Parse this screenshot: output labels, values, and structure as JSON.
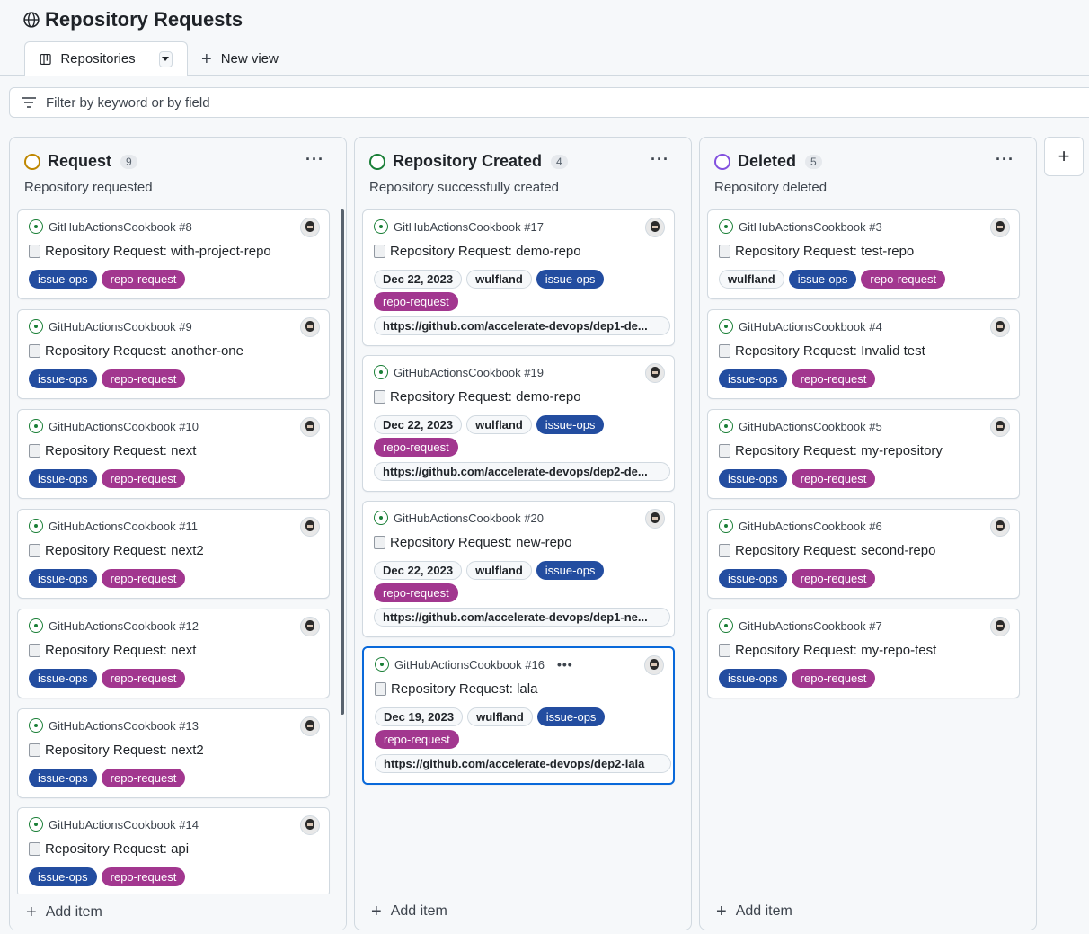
{
  "project": {
    "title": "Repository Requests",
    "icon": "globe-icon"
  },
  "tabs": {
    "active_label": "Repositories",
    "new_view_label": "New view"
  },
  "filter": {
    "placeholder": "Filter by keyword or by field"
  },
  "colors": {
    "request": "#bf8700",
    "created": "#1a7f37",
    "deleted": "#8250df",
    "issue_ops": "#234da0",
    "repo_request": "#a2378f",
    "selected": "#0969da"
  },
  "columns": [
    {
      "title": "Request",
      "count": "9",
      "description": "Repository requested",
      "add_item": "Add item",
      "cards": [
        {
          "repo": "GitHubActionsCookbook #8",
          "title": "Repository Request: with-project-repo",
          "labels": [
            "issue-ops",
            "repo-request"
          ]
        },
        {
          "repo": "GitHubActionsCookbook #9",
          "title": "Repository Request: another-one",
          "labels": [
            "issue-ops",
            "repo-request"
          ]
        },
        {
          "repo": "GitHubActionsCookbook #10",
          "title": "Repository Request: next",
          "labels": [
            "issue-ops",
            "repo-request"
          ]
        },
        {
          "repo": "GitHubActionsCookbook #11",
          "title": "Repository Request: next2",
          "labels": [
            "issue-ops",
            "repo-request"
          ]
        },
        {
          "repo": "GitHubActionsCookbook #12",
          "title": "Repository Request: next",
          "labels": [
            "issue-ops",
            "repo-request"
          ]
        },
        {
          "repo": "GitHubActionsCookbook #13",
          "title": "Repository Request: next2",
          "labels": [
            "issue-ops",
            "repo-request"
          ]
        },
        {
          "repo": "GitHubActionsCookbook #14",
          "title": "Repository Request: api",
          "labels": [
            "issue-ops",
            "repo-request"
          ]
        }
      ]
    },
    {
      "title": "Repository Created",
      "count": "4",
      "description": "Repository successfully created",
      "add_item": "Add item",
      "cards": [
        {
          "repo": "GitHubActionsCookbook #17",
          "title": "Repository Request: demo-repo",
          "date": "Dec 22, 2023",
          "assignee": "wulfland",
          "labels": [
            "issue-ops",
            "repo-request"
          ],
          "url": "https://github.com/accelerate-devops/dep1-de..."
        },
        {
          "repo": "GitHubActionsCookbook #19",
          "title": "Repository Request: demo-repo",
          "date": "Dec 22, 2023",
          "assignee": "wulfland",
          "labels": [
            "issue-ops",
            "repo-request"
          ],
          "url": "https://github.com/accelerate-devops/dep2-de..."
        },
        {
          "repo": "GitHubActionsCookbook #20",
          "title": "Repository Request: new-repo",
          "date": "Dec 22, 2023",
          "assignee": "wulfland",
          "labels": [
            "issue-ops",
            "repo-request"
          ],
          "url": "https://github.com/accelerate-devops/dep1-ne..."
        },
        {
          "repo": "GitHubActionsCookbook #16",
          "more": "•••",
          "title": "Repository Request: lala",
          "date": "Dec 19, 2023",
          "assignee": "wulfland",
          "labels": [
            "issue-ops",
            "repo-request"
          ],
          "url": "https://github.com/accelerate-devops/dep2-lala"
        }
      ]
    },
    {
      "title": "Deleted",
      "count": "5",
      "description": "Repository deleted",
      "add_item": "Add item",
      "cards": [
        {
          "repo": "GitHubActionsCookbook #3",
          "title": "Repository Request: test-repo",
          "assignee": "wulfland",
          "labels": [
            "issue-ops",
            "repo-request"
          ]
        },
        {
          "repo": "GitHubActionsCookbook #4",
          "title": "Repository Request: Invalid test",
          "labels": [
            "issue-ops",
            "repo-request"
          ]
        },
        {
          "repo": "GitHubActionsCookbook #5",
          "title": "Repository Request: my-repository",
          "labels": [
            "issue-ops",
            "repo-request"
          ]
        },
        {
          "repo": "GitHubActionsCookbook #6",
          "title": "Repository Request: second-repo",
          "labels": [
            "issue-ops",
            "repo-request"
          ]
        },
        {
          "repo": "GitHubActionsCookbook #7",
          "title": "Repository Request: my-repo-test",
          "labels": [
            "issue-ops",
            "repo-request"
          ]
        }
      ]
    }
  ]
}
